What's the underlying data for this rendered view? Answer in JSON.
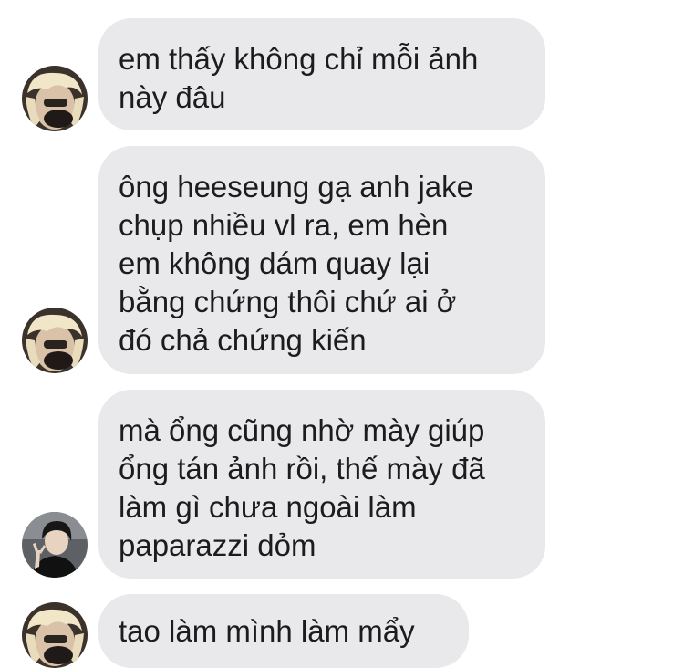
{
  "messages": [
    {
      "sender": "blonde",
      "lines": [
        "em thấy không chỉ mỗi ảnh",
        "này đâu"
      ]
    },
    {
      "sender": "blonde",
      "lines": [
        "ông heeseung gạ anh jake",
        "chụp nhiều vl ra, em hèn",
        "em không dám quay lại",
        "bằng chứng thôi chứ ai ở",
        "đó chả chứng kiến"
      ]
    },
    {
      "sender": "dark",
      "lines": [
        "mà ổng cũng nhờ mày giúp",
        "ổng tán ảnh rồi, thế mày đã",
        "làm gì chưa ngoài làm",
        "paparazzi dỏm"
      ]
    },
    {
      "sender": "blonde",
      "lines": [
        "tao làm mình làm mẩy"
      ]
    }
  ],
  "colors": {
    "bubble_background": "#e9e9eb",
    "text": "#1c1c1e",
    "page_background": "#ffffff"
  }
}
